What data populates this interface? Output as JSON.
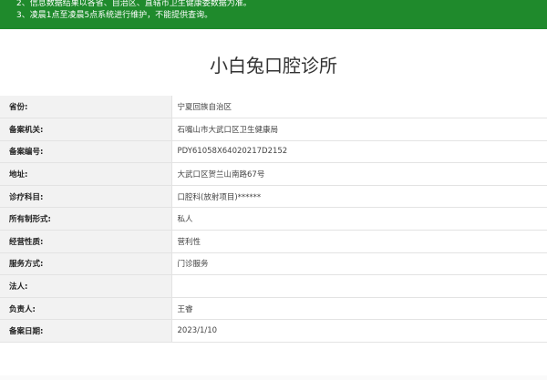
{
  "notice": {
    "line2": "2、信息数据结果以各省、自治区、直辖市卫生健康委数据为准。",
    "line3": "3、凌晨1点至凌晨5点系统进行维护，不能提供查询。"
  },
  "clinic_title": "小白兔口腔诊所",
  "rows": [
    {
      "key": "省份:",
      "value": "宁夏回族自治区"
    },
    {
      "key": "备案机关:",
      "value": "石嘴山市大武口区卫生健康局"
    },
    {
      "key": "备案编号:",
      "value": "PDY61058X64020217D2152"
    },
    {
      "key": "地址:",
      "value": "大武口区贺兰山南路67号"
    },
    {
      "key": "诊疗科目:",
      "value": "口腔科(放射项目)******"
    },
    {
      "key": "所有制形式:",
      "value": "私人"
    },
    {
      "key": "经营性质:",
      "value": "营利性"
    },
    {
      "key": "服务方式:",
      "value": "门诊服务"
    },
    {
      "key": "法人:",
      "value": ""
    },
    {
      "key": "负责人:",
      "value": "王睿"
    },
    {
      "key": "备案日期:",
      "value": "2023/1/10"
    }
  ]
}
